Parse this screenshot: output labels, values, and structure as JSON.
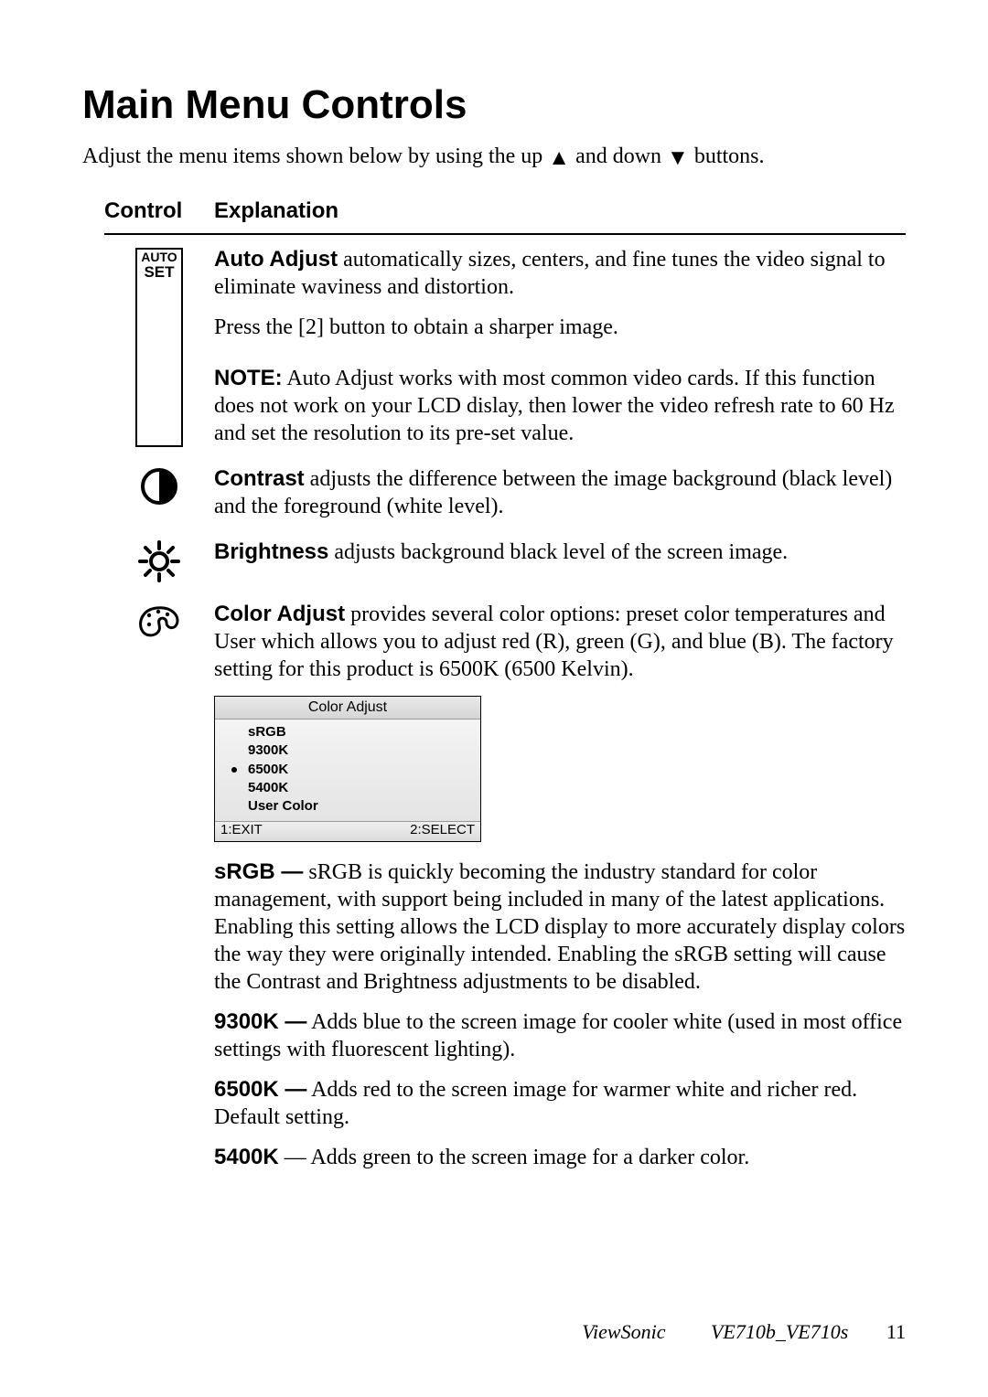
{
  "title": "Main Menu Controls",
  "intro_pre": "Adjust the menu items shown below by using the up ",
  "intro_mid": " and down ",
  "intro_post": " buttons.",
  "headers": {
    "control": "Control",
    "explanation": "Explanation"
  },
  "autoset": {
    "l1": "AUTO",
    "l2": "SET"
  },
  "auto_adjust": {
    "label": "Auto  Adjust",
    "p1_rest": " automatically sizes, centers, and fine tunes the video signal to eliminate waviness and distortion.",
    "p2": "Press the [2] button to obtain a sharper image.",
    "note_label": "NOTE:",
    "note_text": " Auto Adjust works with most common video cards. If this function does not work on your LCD dislay, then lower the video refresh rate to 60 Hz and set the resolution to its pre-set value."
  },
  "contrast": {
    "label": "Contrast",
    "text": " adjusts the difference between the image background (black level) and the foreground (white level)."
  },
  "brightness": {
    "label": "Brightness",
    "text": " adjusts background black level of the screen image."
  },
  "color_adjust": {
    "label": "Color Adjust",
    "text": " provides several color options: preset color temperatures and User which allows you to adjust red (R), green (G), and blue (B). The factory setting for this product is 6500K (6500 Kelvin)."
  },
  "osd": {
    "title": "Color Adjust",
    "items": [
      "sRGB",
      "9300K",
      "6500K",
      "5400K",
      "User Color"
    ],
    "selected_index": 2,
    "exit": "1:EXIT",
    "select": "2:SELECT"
  },
  "srgb": {
    "label": "sRGB —",
    "text": " sRGB is quickly becoming the industry standard for color management, with support being included in many of the latest applications. Enabling this setting allows the LCD display to more accurately display colors the way they were originally intended. Enabling the sRGB setting will cause the Contrast and Brightness adjustments to be disabled."
  },
  "k9300": {
    "label": "9300K —",
    "text": " Adds blue to the screen image for cooler white (used in most office settings with fluorescent lighting)."
  },
  "k6500": {
    "label": "6500K —",
    "text": " Adds red to the screen image for warmer white and richer red. Default setting."
  },
  "k5400": {
    "label": "5400K",
    "dash": " — ",
    "text": "Adds green to the screen image for a darker color."
  },
  "footer": {
    "brand": "ViewSonic",
    "model": "VE710b_VE710s",
    "page": "11"
  },
  "chart_data": {
    "type": "table",
    "title": "Main Menu Controls",
    "columns": [
      "Control",
      "Explanation"
    ],
    "rows": [
      [
        "AUTO SET",
        "Auto Adjust automatically sizes, centers, and fine tunes the video signal to eliminate waviness and distortion. Press the [2] button to obtain a sharper image. NOTE: Auto Adjust works with most common video cards. If this function does not work on your LCD dislay, then lower the video refresh rate to 60 Hz and set the resolution to its pre-set value."
      ],
      [
        "Contrast",
        "Contrast adjusts the difference between the image background (black level) and the foreground (white level)."
      ],
      [
        "Brightness",
        "Brightness adjusts background black level of the screen image."
      ],
      [
        "Color Adjust",
        "Color Adjust provides several color options: preset color temperatures and User which allows you to adjust red (R), green (G), and blue (B). The factory setting for this product is 6500K (6500 Kelvin). Options: sRGB, 9300K, 6500K (selected), 5400K, User Color. sRGB — sRGB is quickly becoming the industry standard for color management, with support being included in many of the latest applications. Enabling this setting allows the LCD display to more accurately display colors the way they were originally intended. Enabling the sRGB setting will cause the Contrast and Brightness adjustments to be disabled. 9300K — Adds blue to the screen image for cooler white (used in most office settings with fluorescent lighting). 6500K — Adds red to the screen image for warmer white and richer red. Default setting. 5400K — Adds green to the screen image for a darker color."
      ]
    ]
  }
}
